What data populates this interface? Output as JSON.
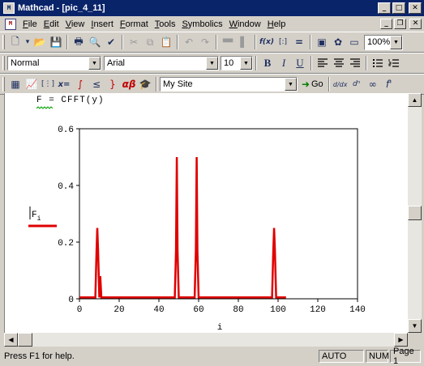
{
  "window": {
    "app_title": "Mathcad - [pic_4_11]",
    "icon_label": "M",
    "min_icon": "minimize-icon",
    "max_icon": "maximize-icon",
    "close_icon": "close-icon"
  },
  "menubar": {
    "doc_icon_label": "M",
    "items": [
      "File",
      "Edit",
      "View",
      "Insert",
      "Format",
      "Tools",
      "Symbolics",
      "Window",
      "Help"
    ]
  },
  "standard_toolbar": {
    "buttons": [
      {
        "name": "new-document-icon",
        "glyph": "🗋"
      },
      {
        "name": "new-dropdown-icon",
        "glyph": "▾"
      },
      {
        "name": "open-folder-icon",
        "glyph": "📂"
      },
      {
        "name": "save-icon",
        "glyph": "💾"
      },
      {
        "name": "print-icon",
        "glyph": "🖶"
      },
      {
        "name": "print-preview-icon",
        "glyph": "🔍"
      },
      {
        "name": "spell-check-icon",
        "glyph": "✔"
      },
      {
        "name": "cut-icon",
        "glyph": "✂"
      },
      {
        "name": "copy-icon",
        "glyph": "⧉"
      },
      {
        "name": "paste-icon",
        "glyph": "📋"
      },
      {
        "name": "undo-icon",
        "glyph": "↶"
      },
      {
        "name": "redo-icon",
        "glyph": "↷"
      },
      {
        "name": "align-across-icon",
        "glyph": "▀▀"
      },
      {
        "name": "align-down-icon",
        "glyph": "▌"
      },
      {
        "name": "insert-function-icon",
        "glyph": "f(x)"
      },
      {
        "name": "insert-unit-icon",
        "glyph": "[:]"
      },
      {
        "name": "calculate-icon",
        "glyph": "="
      },
      {
        "name": "component-icon",
        "glyph": "▣"
      },
      {
        "name": "resource-center-icon",
        "glyph": "✿"
      },
      {
        "name": "region-icon",
        "glyph": "▭"
      }
    ],
    "zoom_value": "100%"
  },
  "formatting_toolbar": {
    "style_value": "Normal",
    "font_value": "Arial",
    "size_value": "10",
    "bold": "B",
    "italic": "I",
    "underline": "U",
    "align_left_icon": "align-left-icon",
    "align_center_icon": "align-center-icon",
    "align_right_icon": "align-right-icon",
    "bullets_icon": "bullets-icon",
    "numbering_icon": "numbering-icon"
  },
  "math_toolbar": {
    "buttons": [
      {
        "name": "calculator-icon",
        "glyph": "▦"
      },
      {
        "name": "graph-icon",
        "glyph": "📈"
      },
      {
        "name": "matrix-icon",
        "glyph": "[⋮]"
      },
      {
        "name": "evaluation-icon",
        "glyph": "x="
      },
      {
        "name": "calculus-icon",
        "glyph": "∫"
      },
      {
        "name": "boolean-icon",
        "glyph": "≤"
      },
      {
        "name": "programming-icon",
        "glyph": "}"
      },
      {
        "name": "greek-icon",
        "glyph": "αβ"
      },
      {
        "name": "symbolic-icon",
        "glyph": "🎓"
      }
    ],
    "site_value": "My Site",
    "go_label": "Go",
    "right_buttons": [
      {
        "name": "derivative-icon",
        "glyph": "d/dx"
      },
      {
        "name": "nth-derivative-icon",
        "glyph": "dⁿ"
      },
      {
        "name": "infinity-icon",
        "glyph": "∞"
      },
      {
        "name": "prime-icon",
        "glyph": "f'"
      }
    ]
  },
  "worksheet": {
    "formula_text": "F = CFFT(y)",
    "plot_y_label": "F",
    "plot_y_subscript": "i",
    "plot_x_label": "i"
  },
  "chart_data": {
    "type": "line",
    "title": "",
    "xlabel": "i",
    "ylabel": "Fi",
    "xlim": [
      0,
      140
    ],
    "ylim": [
      0,
      0.6
    ],
    "x_ticks": [
      "0",
      "20",
      "40",
      "60",
      "80",
      "100",
      "120",
      "140"
    ],
    "y_ticks": [
      "0",
      "0.2",
      "0.4",
      "0.6"
    ],
    "grid": false,
    "series_color": "#e00000",
    "series": [
      {
        "name": "",
        "x": [
          0,
          7,
          8,
          8.6,
          9,
          9.4,
          10,
          10.5,
          11,
          12,
          47,
          48,
          48.6,
          49,
          49.4,
          50,
          51,
          57,
          58,
          58.6,
          59,
          59.4,
          60,
          61,
          96,
          97,
          97.6,
          98,
          98.4,
          99,
          100,
          104
        ],
        "y": [
          0.005,
          0.005,
          0.005,
          0.17,
          0.25,
          0.17,
          0.005,
          0.08,
          0.005,
          0.005,
          0.005,
          0.005,
          0.17,
          0.5,
          0.17,
          0.005,
          0.005,
          0.005,
          0.005,
          0.17,
          0.5,
          0.17,
          0.005,
          0.005,
          0.005,
          0.005,
          0.17,
          0.25,
          0.17,
          0.005,
          0.005,
          0.005
        ]
      }
    ]
  },
  "scrollbars": {
    "up_icon": "scroll-up-icon",
    "down_icon": "scroll-down-icon",
    "left_icon": "scroll-left-icon",
    "right_icon": "scroll-right-icon"
  },
  "statusbar": {
    "help_text": "Press F1 for help.",
    "calc_mode": "AUTO",
    "numlock": "NUM",
    "page": "Page 1"
  }
}
